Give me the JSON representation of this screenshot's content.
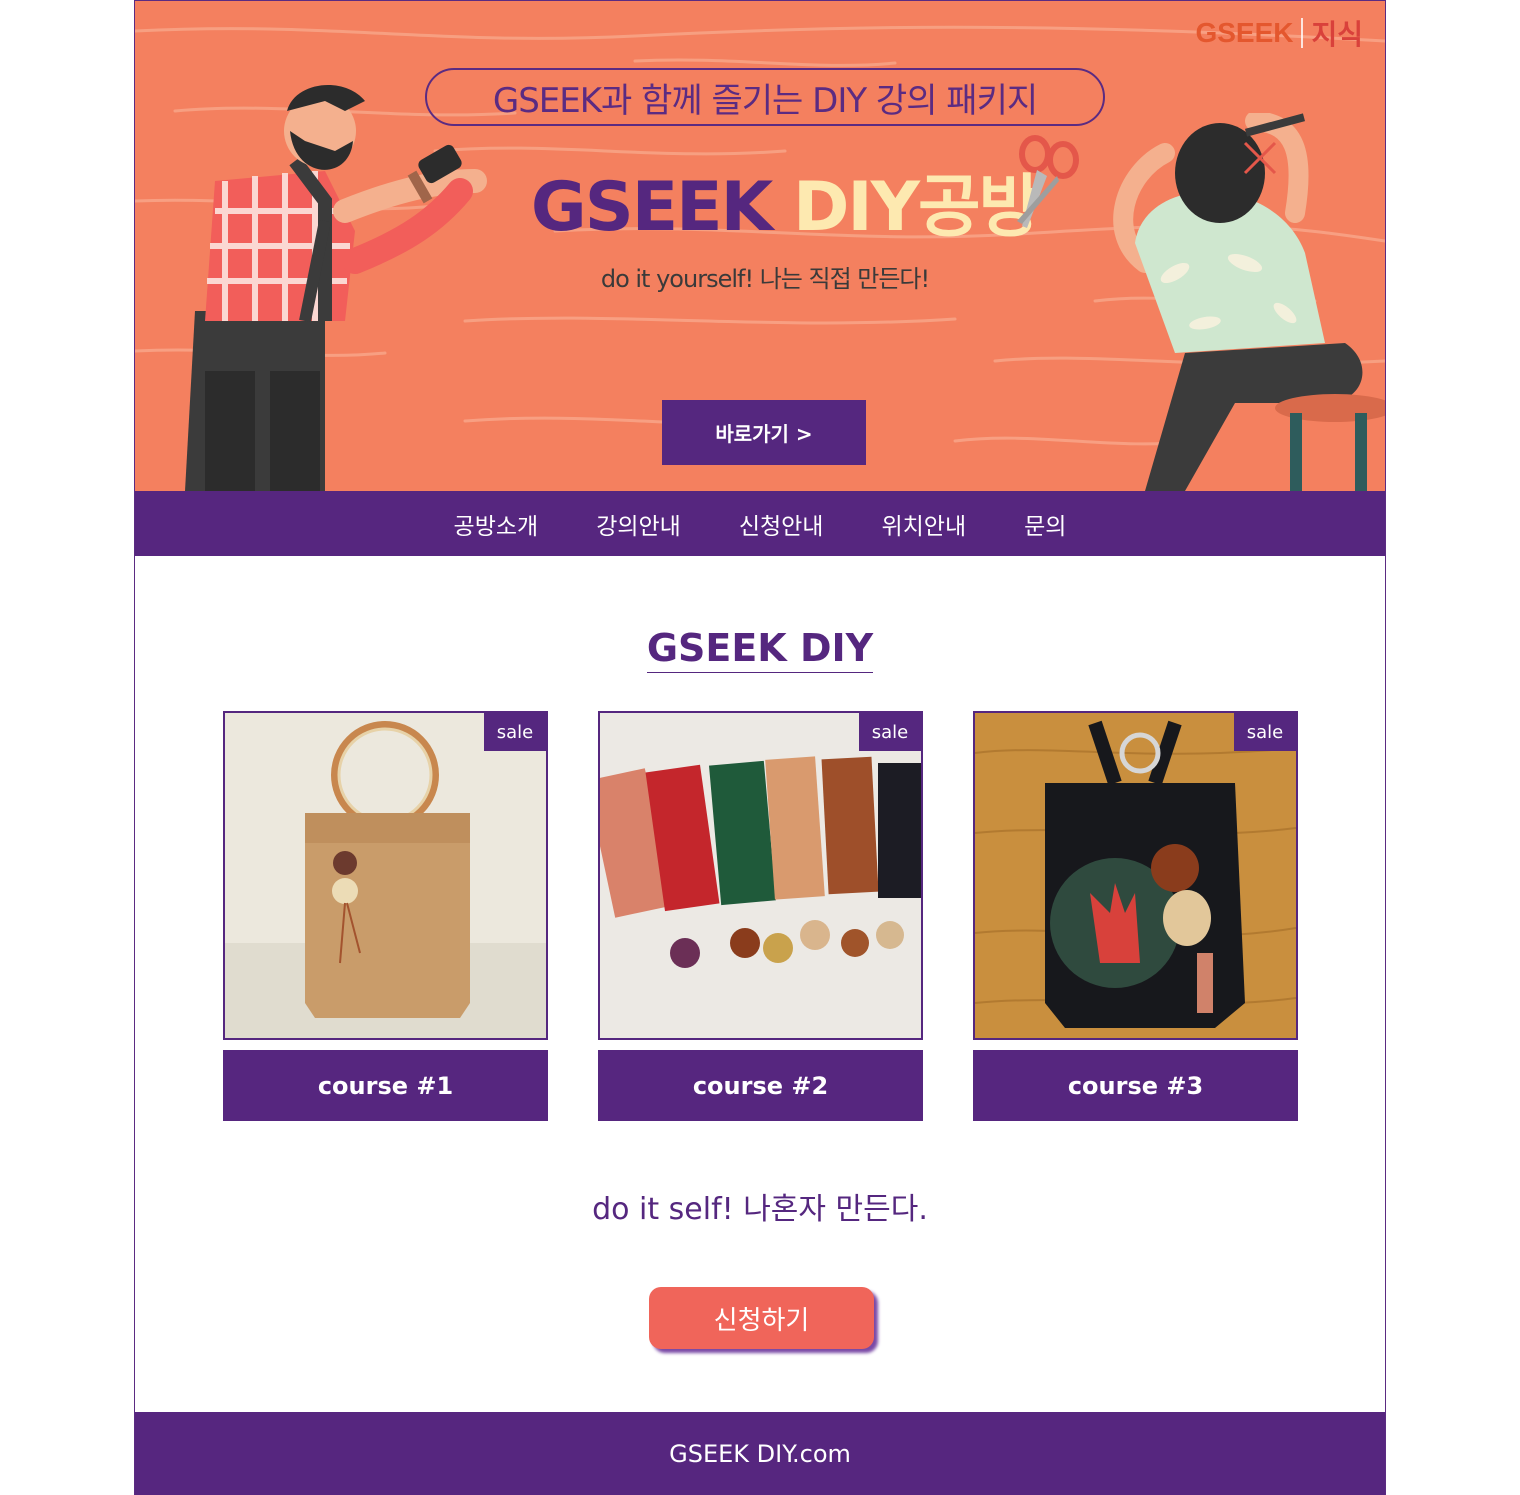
{
  "hero": {
    "logo_left": "GSEEK",
    "logo_right": "지식",
    "pill_text": "GSEEK과 함께 즐기는 DIY 강의 패키지",
    "title_part1": "GSEEK",
    "title_part2": "DIY공방",
    "subtitle": "do it yourself! 나는 직접 만든다!",
    "button_label": "바로가기 >",
    "colors": {
      "background": "#f4805f",
      "accent": "#55277f",
      "title_highlight": "#fde9b0"
    }
  },
  "nav": {
    "items": [
      {
        "label": "공방소개"
      },
      {
        "label": "강의안내"
      },
      {
        "label": "신청안내"
      },
      {
        "label": "위치안내"
      },
      {
        "label": "문의"
      }
    ]
  },
  "section": {
    "title": "GSEEK DIY",
    "cards": [
      {
        "badge": "sale",
        "label": "course #1",
        "image": "tan-leather-tote-bag"
      },
      {
        "badge": "sale",
        "label": "course #2",
        "image": "leather-key-cases-with-wooden-beads"
      },
      {
        "badge": "sale",
        "label": "course #3",
        "image": "black-bucket-bag-with-rabbit-charm"
      }
    ],
    "tagline": "do it self! 나혼자 만든다.",
    "apply_label": "신청하기"
  },
  "footer": {
    "text": "GSEEK DIY.com"
  }
}
